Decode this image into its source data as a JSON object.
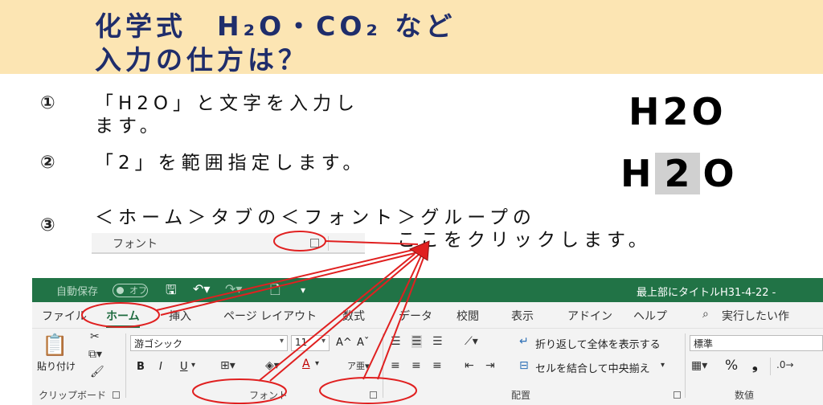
{
  "title": {
    "line1": "化学式　H₂O・CO₂ など",
    "line2": "入力の仕方は？"
  },
  "steps": [
    {
      "num": "①",
      "text_line1": "「H2O」と文字を入力し",
      "text_line2": "ます。"
    },
    {
      "num": "②",
      "text_line1": "「2」を範囲指定します。"
    },
    {
      "num": "③",
      "text_line1": "＜ホーム＞タブの＜フォント＞グループの",
      "text_line2": "ここをクリックします。"
    }
  ],
  "examples": {
    "h2o_plain": "H2O",
    "h2o_sel_h": "H",
    "h2o_sel_2": "2",
    "h2o_sel_o": "O"
  },
  "font_strip": {
    "label": "フォント"
  },
  "excel": {
    "titlebar": {
      "autosave": "自動保存",
      "toggle": "オフ",
      "save_icon": "save-icon",
      "undo_icon": "undo-icon",
      "new_icon": "new-icon",
      "doc_title": "最上部にタイトルH31-4-22 -"
    },
    "tabs": [
      "ファイル",
      "ホーム",
      "挿入",
      "ページ レイアウト",
      "数式",
      "データ",
      "校閲",
      "表示",
      "アドイン",
      "ヘルプ"
    ],
    "active_tab": "ホーム",
    "tell_me": "実行したい作",
    "clipboard": {
      "paste": "貼り付け",
      "label": "クリップボード"
    },
    "font": {
      "name": "游ゴシック",
      "size": "11",
      "grow": "A^",
      "shrink": "Aˇ",
      "bold": "B",
      "italic": "I",
      "underline": "U",
      "label": "フォント"
    },
    "alignment": {
      "wrap_text": "折り返して全体を表示する",
      "merge_center": "セルを結合して中央揃え",
      "label": "配置"
    },
    "number": {
      "format": "標準",
      "percent": "%",
      "comma": "❟",
      "label": "数値"
    }
  },
  "colors": {
    "title_bg": "#fce5b3",
    "title_fg": "#1f2d6b",
    "excel_green": "#217346",
    "annotation_red": "#e02020"
  }
}
